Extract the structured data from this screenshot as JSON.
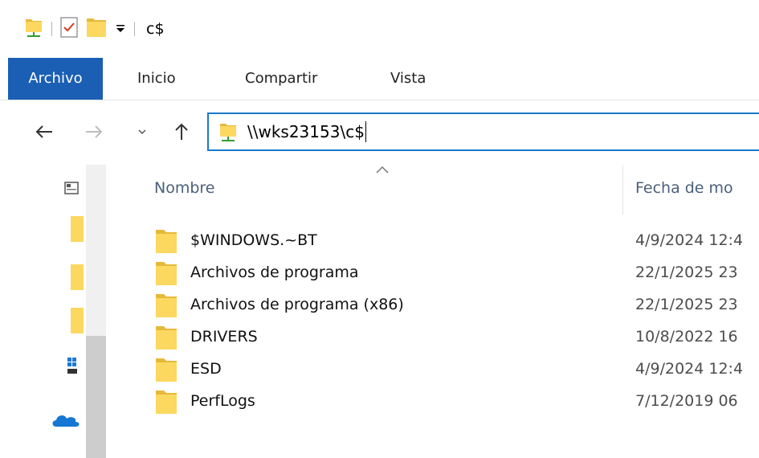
{
  "window": {
    "title": "c$"
  },
  "quick_access": {
    "icons": [
      "network-drive-icon",
      "properties-check-icon",
      "new-folder-icon",
      "customize-dropdown-icon"
    ]
  },
  "ribbon": {
    "tabs": [
      {
        "label": "Archivo",
        "selected": true
      },
      {
        "label": "Inicio"
      },
      {
        "label": "Compartir"
      },
      {
        "label": "Vista"
      }
    ],
    "accent": "#1a5fb4"
  },
  "navigation": {
    "address": "\\\\wks23153\\c$",
    "address_border": "#1979ca"
  },
  "columns": {
    "name": "Nombre",
    "date": "Fecha de mo"
  },
  "files": [
    {
      "name": "$WINDOWS.~BT",
      "date": "4/9/2024 12:4"
    },
    {
      "name": "Archivos de programa",
      "date": "22/1/2025 23"
    },
    {
      "name": "Archivos de programa (x86)",
      "date": "22/1/2025 23"
    },
    {
      "name": "DRIVERS",
      "date": "10/8/2022 16"
    },
    {
      "name": "ESD",
      "date": "4/9/2024 12:4"
    },
    {
      "name": "PerfLogs",
      "date": "7/12/2019 06"
    }
  ],
  "nav_pane_icons": [
    "computer-icon",
    "folder-icon",
    "folder-icon",
    "folder-icon",
    "windows-icon",
    "onedrive-icon"
  ],
  "colors": {
    "folder": "#fcd860",
    "folder_dark": "#e6b93a",
    "header_text": "#4c607a"
  }
}
